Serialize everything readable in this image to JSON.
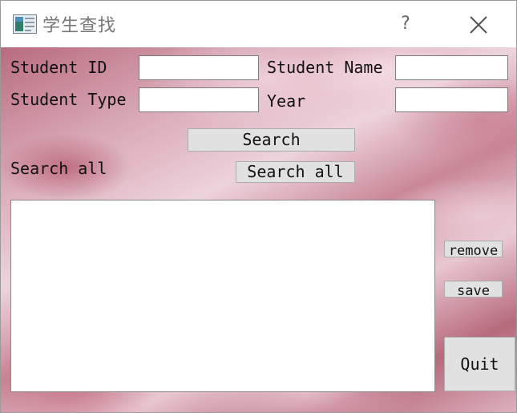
{
  "window": {
    "title": "学生查找",
    "help_label": "?",
    "close_icon": "close-icon",
    "app_icon": "app-icon"
  },
  "form": {
    "student_id_label": "Student ID",
    "student_id_value": "",
    "student_name_label": "Student Name",
    "student_name_value": "",
    "student_type_label": "Student Type",
    "student_type_value": "",
    "year_label": "Year",
    "year_value": ""
  },
  "actions": {
    "search_label": "Search",
    "search_all_caption": "Search all",
    "search_all_label": "Search all",
    "remove_label": "remove",
    "save_label": "save",
    "quit_label": "Quit"
  },
  "results": {
    "items": []
  },
  "colors": {
    "button_face": "#e1e1e1",
    "background_tone": "#d9a9b6"
  }
}
